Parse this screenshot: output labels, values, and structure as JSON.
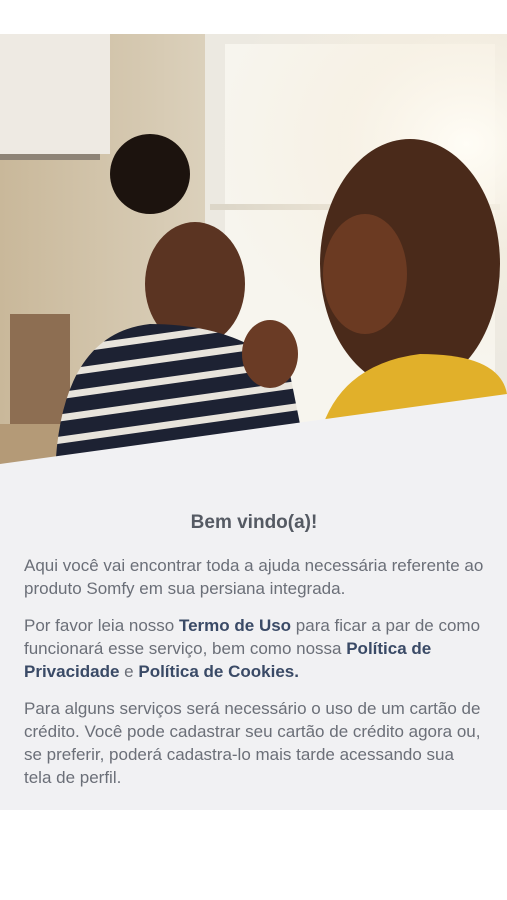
{
  "welcome": {
    "title": "Bem vindo(a)!",
    "paragraph1": "Aqui você vai encontrar toda a ajuda necessária referente ao produto Somfy em sua persiana integrada.",
    "paragraph2_before": "Por favor leia nosso ",
    "terms_link": "Termo de Uso",
    "paragraph2_middle": " para ficar a par de como funcionará esse serviço, bem como nossa ",
    "privacy_link": "Política de Privacidade",
    "paragraph2_and": " e ",
    "cookies_link": "Política de Cookies.",
    "paragraph3": "Para alguns serviços será necessário o uso de um cartão de crédito. Você pode cadastrar seu cartão de crédito agora ou, se preferir, poderá cadastra-lo mais tarde acessando sua tela de perfil."
  },
  "colors": {
    "panel_background": "#f1f1f3",
    "link": "#3a4a66",
    "body_text": "#6b6f78"
  }
}
